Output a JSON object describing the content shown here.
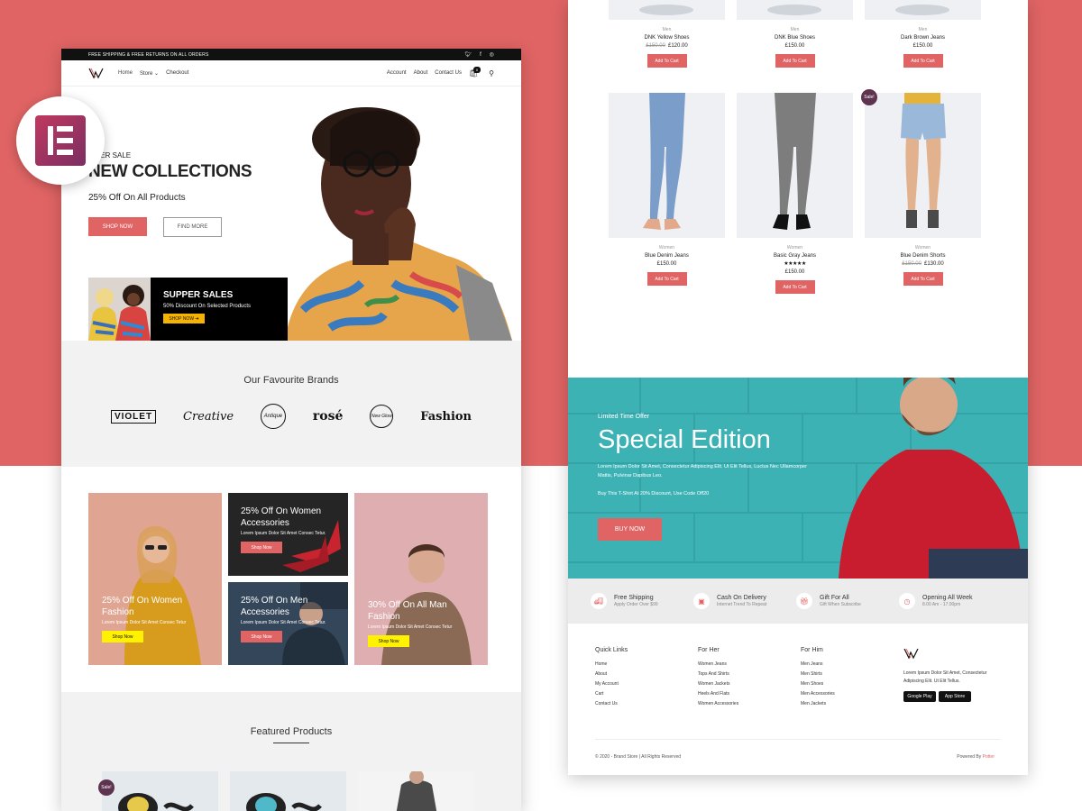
{
  "colors": {
    "background": "#e06464",
    "accent": "#e06464",
    "dark": "#111111",
    "sale_badge": "#5d3350",
    "teal": "#3fb4b6"
  },
  "left_page": {
    "topbar": {
      "text": "FREE SHIPPING & FREE RETURNS ON ALL ORDERS",
      "social_icons": [
        "twitter-icon",
        "facebook-icon",
        "instagram-icon"
      ]
    },
    "nav": {
      "home": "Home",
      "store": "Store",
      "checkout": "Checkout",
      "account": "Account",
      "about": "About",
      "contact": "Contact Us",
      "cart_count": "0"
    },
    "hero": {
      "kicker": "MMER SALE",
      "title": "NEW COLLECTIONS",
      "subtitle": "25% Off On All Products",
      "shop_now": "SHOP NOW",
      "find_more": "FIND MORE"
    },
    "promo": {
      "title": "SUPPER SALES",
      "subtitle": "50% Discount On Selected Products",
      "button": "SHOP NOW"
    },
    "brands": {
      "heading": "Our Favourite Brands",
      "items": [
        "VIOLET",
        "Creative",
        "Antique",
        "rosé",
        "New Glow",
        "Fashion"
      ]
    },
    "categories": [
      {
        "title": "25% Off On Women Fashion",
        "text": "Lorem Ipsum Dolor Sit Amet Consec Tetur",
        "button": "Shop Now"
      },
      {
        "title": "25% Off On Women Accessories",
        "text": "Lorem Ipsum Dolor Sit Amet Consec Tetur.",
        "button": "Shop Now"
      },
      {
        "title": "25% Off On Men Accessories",
        "text": "Lorem Ipsum Dolor Sit Amet Consec Tetur.",
        "button": "Shop Now"
      },
      {
        "title": "30% Off On All Man Fashion",
        "text": "Lorem Ipsum Dolor Sit Amet Consec Tetur",
        "button": "Shop Now"
      }
    ],
    "featured": {
      "heading": "Featured Products",
      "sale_label": "Sale!"
    }
  },
  "right_page": {
    "products_row1": [
      {
        "category": "Men",
        "name": "DNK Yellow Shoes",
        "old_price": "£150.00",
        "price": "£120.00",
        "button": "Add To Cart"
      },
      {
        "category": "Men",
        "name": "DNK Blue Shoes",
        "old_price": "",
        "price": "£150.00",
        "button": "Add To Cart"
      },
      {
        "category": "Men",
        "name": "Dark Brown Jeans",
        "old_price": "",
        "price": "£150.00",
        "button": "Add To Cart"
      }
    ],
    "products_row2": [
      {
        "category": "Women",
        "name": "Blue Denim Jeans",
        "old_price": "",
        "price": "£150.00",
        "button": "Add To Cart"
      },
      {
        "category": "Women",
        "name": "Basic Gray Jeans",
        "stars": "★★★★★",
        "old_price": "",
        "price": "£150.00",
        "button": "Add To Cart"
      },
      {
        "category": "Women",
        "name": "Blue Denim Shorts",
        "old_price": "£150.00",
        "price": "£130.00",
        "button": "Add To Cart"
      }
    ],
    "sale_label": "Sale!",
    "special": {
      "kicker": "Limited Time Offer",
      "title": "Special Edition",
      "body": "Lorem Ipsum Dolor Sit Amet, Consectetur Adipiscing Elit. Ut Elit Tellus, Luctus Nec Ullamcorper Mattis, Pulvinar Dapibus Leo.",
      "offer": "Buy This T-Shirt At 20% Discount, Use Code Off20",
      "button": "BUY NOW"
    },
    "features": [
      {
        "icon": "truck-icon",
        "title": "Free Shipping",
        "sub": "Apply Order Over $99"
      },
      {
        "icon": "cash-icon",
        "title": "Cash On Delivery",
        "sub": "Internet Trend To Repeat"
      },
      {
        "icon": "gift-icon",
        "title": "Gift For All",
        "sub": "Gift When Subscribe"
      },
      {
        "icon": "clock-icon",
        "title": "Opening All Week",
        "sub": "8.00 Am - 17.00pm"
      }
    ],
    "footer": {
      "quick_links": {
        "title": "Quick Links",
        "items": [
          "Home",
          "About",
          "My Account",
          "Cart",
          "Contact Us"
        ]
      },
      "for_her": {
        "title": "For Her",
        "items": [
          "Women Jeans",
          "Tops And Shirts",
          "Women Jackets",
          "Heels And Flats",
          "Women Accessories"
        ]
      },
      "for_him": {
        "title": "For Him",
        "items": [
          "Men Jeans",
          "Men Shirts",
          "Men Shoes",
          "Men Accessories",
          "Men Jackets"
        ]
      },
      "about_text": "Lorem Ipsum Dolor Sit Amet, Consectetur Adipiscing Elit. Ut Elit Tellus.",
      "google_play": "Google Play",
      "app_store": "App Store",
      "copyright": "© 2020 - Brand Store | All Rights Reserved",
      "powered_by": "Powered By",
      "powered_name": "Potter"
    }
  }
}
